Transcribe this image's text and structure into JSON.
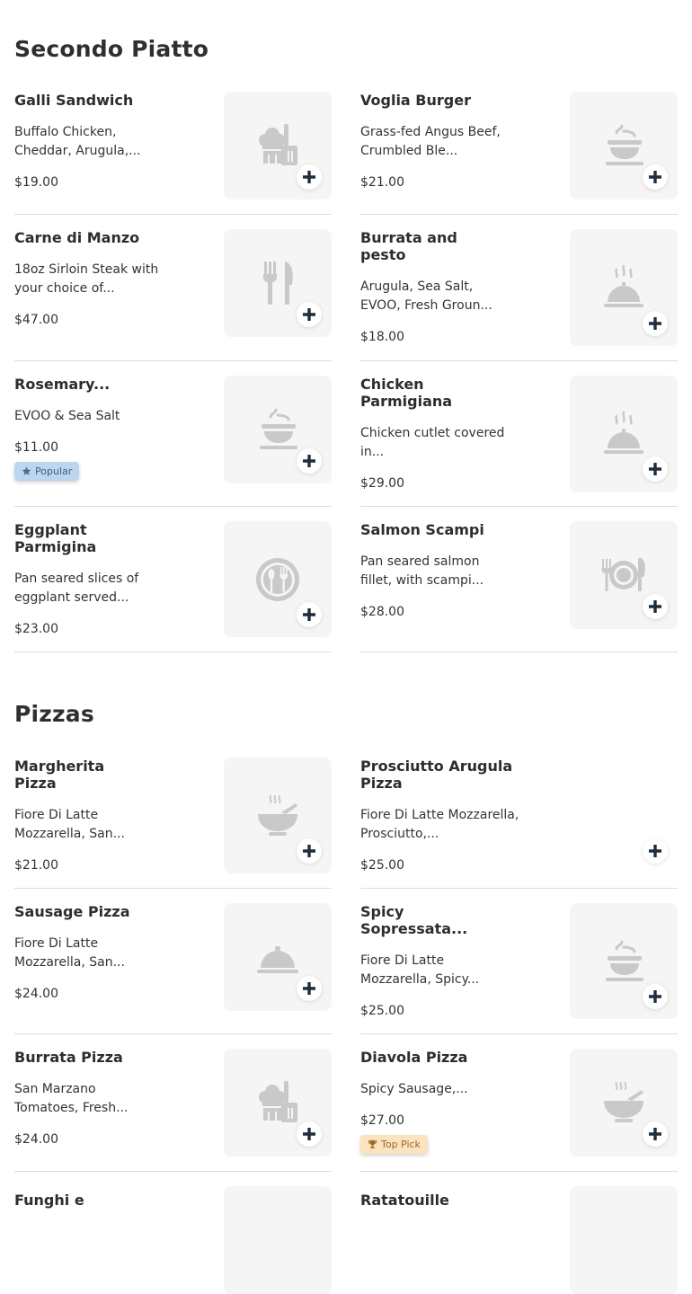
{
  "colors": {
    "icon_gray": "#c9c9c9",
    "plus": "#1f2d3d",
    "thumb_bg": "#f5f5f5"
  },
  "sections": [
    {
      "title": "Secondo Piatto"
    },
    {
      "title": "Pizzas"
    }
  ],
  "items": [
    {
      "name": "Galli Sandwich",
      "desc": "Buffalo Chicken, Cheddar, Arugula,...",
      "price": "$19.00",
      "icon": "chef-icon"
    },
    {
      "name": "Voglia Burger",
      "desc": "Grass-fed Angus Beef, Crumbled Ble...",
      "price": "$21.00",
      "icon": "steaming-dish-icon"
    },
    {
      "name": "Carne di Manzo",
      "desc": "18oz Sirloin Steak with your choice of...",
      "price": "$47.00",
      "icon": "utensils-icon"
    },
    {
      "name": "Burrata and pesto",
      "desc": "Arugula, Sea Salt, EVOO, Fresh Groun...",
      "price": "$18.00",
      "icon": "hot-cloche-icon"
    },
    {
      "name": "Rosemary...",
      "desc": "EVOO & Sea Salt",
      "price": "$11.00",
      "icon": "steaming-dish-icon",
      "badge": "Popular"
    },
    {
      "name": "Chicken Parmigiana",
      "desc": "Chicken cutlet covered in...",
      "price": "$29.00",
      "icon": "hot-cloche-icon"
    },
    {
      "name": "Eggplant Parmigina",
      "desc": "Pan seared slices of eggplant served...",
      "price": "$23.00",
      "icon": "plate-utensils-circle-icon"
    },
    {
      "name": "Salmon Scampi",
      "desc": "Pan seared salmon fillet, with scampi...",
      "price": "$28.00",
      "icon": "plate-utensils-icon"
    },
    {
      "name": "Margherita Pizza",
      "desc": "Fiore Di Latte Mozzarella, San...",
      "price": "$21.00",
      "icon": "soup-bowl-icon"
    },
    {
      "name": "Prosciutto Arugula Pizza",
      "desc": "Fiore Di Latte Mozzarella, Prosciutto,...",
      "price": "$25.00",
      "icon": ""
    },
    {
      "name": "Sausage Pizza",
      "desc": "Fiore Di Latte Mozzarella, San...",
      "price": "$24.00",
      "icon": "cloche-icon"
    },
    {
      "name": "Spicy Sopressata...",
      "desc": "Fiore Di Latte Mozzarella, Spicy...",
      "price": "$25.00",
      "icon": "steaming-dish-icon"
    },
    {
      "name": "Burrata Pizza",
      "desc": "San Marzano Tomatoes, Fresh...",
      "price": "$24.00",
      "icon": "chef-icon"
    },
    {
      "name": "Diavola Pizza",
      "desc": "Spicy Sausage,...",
      "price": "$27.00",
      "icon": "soup-bowl-icon",
      "badge": "Top Pick"
    },
    {
      "name": "Funghi e",
      "desc": "",
      "price": "",
      "icon": ""
    },
    {
      "name": "Ratatouille",
      "desc": "",
      "price": "",
      "icon": ""
    }
  ]
}
